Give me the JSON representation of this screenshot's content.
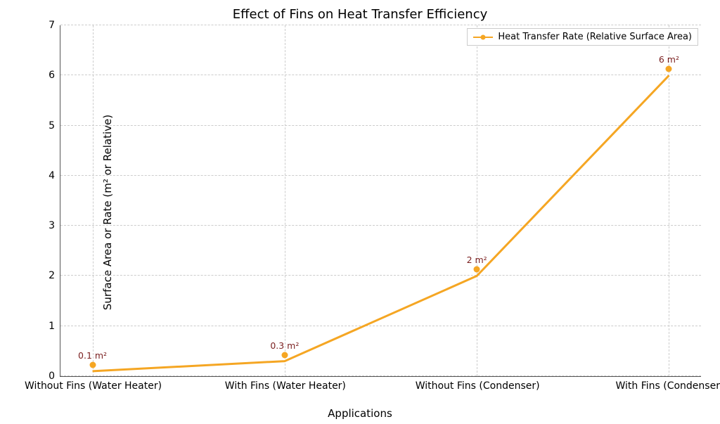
{
  "chart_data": {
    "type": "line",
    "title": "Effect of Fins on Heat Transfer Efficiency",
    "xlabel": "Applications",
    "ylabel": "Surface Area or Rate (m² or Relative)",
    "ylim": [
      0,
      7
    ],
    "yticks": [
      0,
      1,
      2,
      3,
      4,
      5,
      6,
      7
    ],
    "categories": [
      "Without Fins (Water Heater)",
      "With Fins (Water Heater)",
      "Without Fins (Condenser)",
      "With Fins (Condenser)"
    ],
    "series": [
      {
        "name": "Heat Transfer Rate (Relative Surface Area)",
        "values": [
          0.1,
          0.3,
          2,
          6
        ],
        "annotations": [
          "0.1 m²",
          "0.3 m²",
          "2 m²",
          "6 m²"
        ],
        "color": "#f5a623"
      }
    ],
    "legend_position": "upper-right",
    "grid": true
  }
}
